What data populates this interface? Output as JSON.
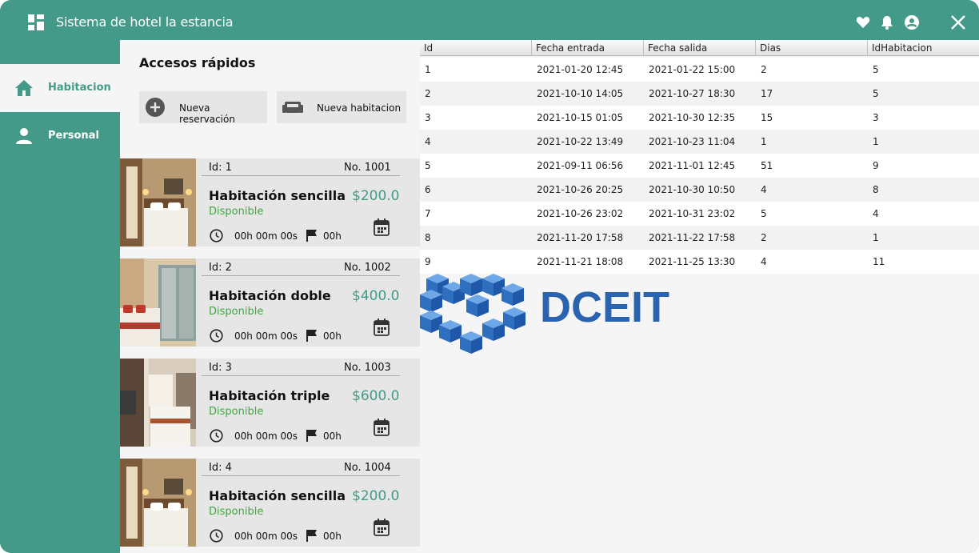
{
  "app": {
    "title": "Sistema de hotel la estancia"
  },
  "titlebar_icons": [
    "heart-icon",
    "bell-icon",
    "account-icon",
    "close-icon"
  ],
  "colors": {
    "primary": "#449a88",
    "status_available": "#3caa3c",
    "panel": "#f5f5f5",
    "card": "#e6e6e6"
  },
  "sidebar": {
    "items": [
      {
        "label": "Habitacion",
        "icon": "home-icon",
        "active": true
      },
      {
        "label": "Personal",
        "icon": "person-icon",
        "active": false
      }
    ]
  },
  "quick_access": {
    "title": "Accesos rápidos",
    "buttons": [
      {
        "label": "Nueva reservación",
        "icon": "add-circle-icon"
      },
      {
        "label": "Nueva habitacion",
        "icon": "sofa-icon"
      }
    ]
  },
  "rooms": [
    {
      "id": "Id: 1",
      "number": "No. 1001",
      "name": "Habitación sencilla",
      "price": "$200.0",
      "status": "Disponible",
      "time": "00h 00m 00s",
      "hours": "00h"
    },
    {
      "id": "Id: 2",
      "number": "No. 1002",
      "name": "Habitación doble",
      "price": "$400.0",
      "status": "Disponible",
      "time": "00h 00m 00s",
      "hours": "00h"
    },
    {
      "id": "Id: 3",
      "number": "No. 1003",
      "name": "Habitación triple",
      "price": "$600.0",
      "status": "Disponible",
      "time": "00h 00m 00s",
      "hours": "00h"
    },
    {
      "id": "Id: 4",
      "number": "No. 1004",
      "name": "Habitación sencilla",
      "price": "$200.0",
      "status": "Disponible",
      "time": "00h 00m 00s",
      "hours": "00h"
    }
  ],
  "table": {
    "columns": [
      "Id",
      "Fecha entrada",
      "Fecha salida",
      "Dias",
      "IdHabitacion"
    ],
    "rows": [
      [
        "1",
        "2021-01-20 12:45",
        "2021-01-22 15:00",
        "2",
        "5"
      ],
      [
        "2",
        "2021-10-10 14:05",
        "2021-10-27 18:30",
        "17",
        "5"
      ],
      [
        "3",
        "2021-10-15 01:05",
        "2021-10-30 12:35",
        "15",
        "3"
      ],
      [
        "4",
        "2021-10-22 13:49",
        "2021-10-23 11:04",
        "1",
        "1"
      ],
      [
        "5",
        "2021-09-11 06:56",
        "2021-11-01 12:45",
        "51",
        "9"
      ],
      [
        "6",
        "2021-10-26 20:25",
        "2021-10-30 10:50",
        "4",
        "8"
      ],
      [
        "7",
        "2021-10-26 23:02",
        "2021-10-31 23:02",
        "5",
        "4"
      ],
      [
        "8",
        "2021-11-20 17:58",
        "2021-11-22 17:58",
        "2",
        "1"
      ],
      [
        "9",
        "2021-11-21 18:08",
        "2021-11-25 13:30",
        "4",
        "11"
      ]
    ]
  },
  "logo": {
    "text": "DCEIT"
  }
}
